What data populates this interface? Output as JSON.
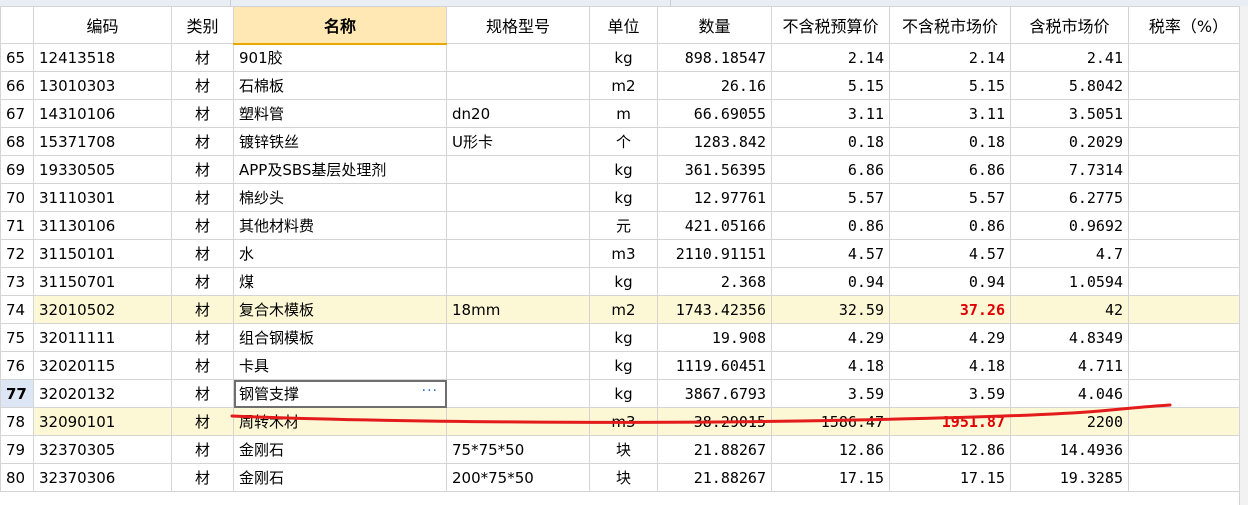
{
  "columns": {
    "rownum": "",
    "code": "编码",
    "category": "类别",
    "name": "名称",
    "spec": "规格型号",
    "unit": "单位",
    "quantity": "数量",
    "budget_price_excl_tax": "不含税预算价",
    "market_price_excl_tax": "不含税市场价",
    "market_price_incl_tax": "含税市场价",
    "tax_rate": "税率（%）"
  },
  "current_row": "77",
  "rows": [
    {
      "n": "65",
      "code": "12413518",
      "cat": "材",
      "name": "901胶",
      "spec": "",
      "unit": "kg",
      "qty": "898.18547",
      "budget": "2.14",
      "market": "2.14",
      "incl": "2.41",
      "tax": ""
    },
    {
      "n": "66",
      "code": "13010303",
      "cat": "材",
      "name": "石棉板",
      "spec": "",
      "unit": "m2",
      "qty": "26.16",
      "budget": "5.15",
      "market": "5.15",
      "incl": "5.8042",
      "tax": ""
    },
    {
      "n": "67",
      "code": "14310106",
      "cat": "材",
      "name": "塑料管",
      "spec": "dn20",
      "unit": "m",
      "qty": "66.69055",
      "budget": "3.11",
      "market": "3.11",
      "incl": "3.5051",
      "tax": ""
    },
    {
      "n": "68",
      "code": "15371708",
      "cat": "材",
      "name": "镀锌铁丝",
      "spec": "U形卡",
      "unit": "个",
      "qty": "1283.842",
      "budget": "0.18",
      "market": "0.18",
      "incl": "0.2029",
      "tax": ""
    },
    {
      "n": "69",
      "code": "19330505",
      "cat": "材",
      "name": "APP及SBS基层处理剂",
      "spec": "",
      "unit": "kg",
      "qty": "361.56395",
      "budget": "6.86",
      "market": "6.86",
      "incl": "7.7314",
      "tax": ""
    },
    {
      "n": "70",
      "code": "31110301",
      "cat": "材",
      "name": "棉纱头",
      "spec": "",
      "unit": "kg",
      "qty": "12.97761",
      "budget": "5.57",
      "market": "5.57",
      "incl": "6.2775",
      "tax": ""
    },
    {
      "n": "71",
      "code": "31130106",
      "cat": "材",
      "name": "其他材料费",
      "spec": "",
      "unit": "元",
      "qty": "421.05166",
      "budget": "0.86",
      "market": "0.86",
      "incl": "0.9692",
      "tax": ""
    },
    {
      "n": "72",
      "code": "31150101",
      "cat": "材",
      "name": "水",
      "spec": "",
      "unit": "m3",
      "qty": "2110.91151",
      "budget": "4.57",
      "market": "4.57",
      "incl": "4.7",
      "tax": ""
    },
    {
      "n": "73",
      "code": "31150701",
      "cat": "材",
      "name": "煤",
      "spec": "",
      "unit": "kg",
      "qty": "2.368",
      "budget": "0.94",
      "market": "0.94",
      "incl": "1.0594",
      "tax": ""
    },
    {
      "n": "74",
      "code": "32010502",
      "cat": "材",
      "name": "复合木模板",
      "spec": "18mm",
      "unit": "m2",
      "qty": "1743.42356",
      "budget": "32.59",
      "market": "37.26",
      "incl": "42",
      "tax": "",
      "hl": true,
      "red": true
    },
    {
      "n": "75",
      "code": "32011111",
      "cat": "材",
      "name": "组合钢模板",
      "spec": "",
      "unit": "kg",
      "qty": "19.908",
      "budget": "4.29",
      "market": "4.29",
      "incl": "4.8349",
      "tax": ""
    },
    {
      "n": "76",
      "code": "32020115",
      "cat": "材",
      "name": "卡具",
      "spec": "",
      "unit": "kg",
      "qty": "1119.60451",
      "budget": "4.18",
      "market": "4.18",
      "incl": "4.711",
      "tax": ""
    },
    {
      "n": "77",
      "code": "32020132",
      "cat": "材",
      "name": "钢管支撑",
      "spec": "",
      "unit": "kg",
      "qty": "3867.6793",
      "budget": "3.59",
      "market": "3.59",
      "incl": "4.046",
      "tax": "",
      "editing": true
    },
    {
      "n": "78",
      "code": "32090101",
      "cat": "材",
      "name": "周转木材",
      "spec": "",
      "unit": "m3",
      "qty": "38.29015",
      "budget": "1586.47",
      "market": "1951.87",
      "incl": "2200",
      "tax": "",
      "hl": true,
      "red": true
    },
    {
      "n": "79",
      "code": "32370305",
      "cat": "材",
      "name": "金刚石",
      "spec": "75*75*50",
      "unit": "块",
      "qty": "21.88267",
      "budget": "12.86",
      "market": "12.86",
      "incl": "14.4936",
      "tax": ""
    },
    {
      "n": "80",
      "code": "32370306",
      "cat": "材",
      "name": "金刚石",
      "spec": "200*75*50",
      "unit": "块",
      "qty": "21.88267",
      "budget": "17.15",
      "market": "17.15",
      "incl": "19.3285",
      "tax": ""
    }
  ],
  "edit_button": "···",
  "colors": {
    "highlight_row": "#fcf8d6",
    "active_header": "#ffe8b3",
    "red_value": "#e00000",
    "annotation_stroke": "#e41b1b"
  }
}
